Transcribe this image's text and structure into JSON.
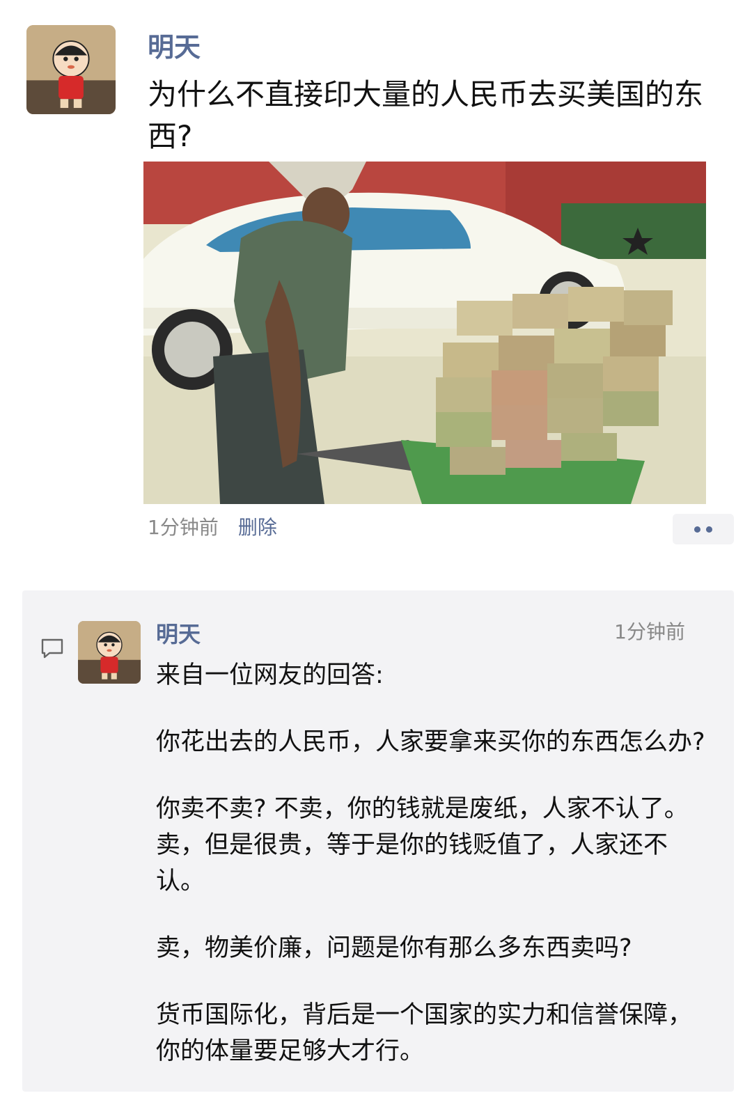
{
  "post": {
    "author": "明天",
    "text": "为什么不直接印大量的人民币去买美国的东西?",
    "time": "1分钟前",
    "delete_label": "删除"
  },
  "comment": {
    "author": "明天",
    "time": "1分钟前",
    "paragraphs": [
      "来自一位网友的回答:",
      "你花出去的人民币，人家要拿来买你的东西怎么办?",
      "你卖不卖? 不卖，你的钱就是废纸，人家不认了。卖，但是很贵，等于是你的钱贬值了，人家还不认。",
      "卖，物美价廉，问题是你有那么多东西卖吗?",
      "货币国际化，背后是一个国家的实力和信誉保障，你的体量要足够大才行。"
    ]
  },
  "icons": {
    "avatar": "cartoon-boy-avatar-icon",
    "comment": "comment-bubble-icon",
    "more": "more-dots-icon"
  }
}
